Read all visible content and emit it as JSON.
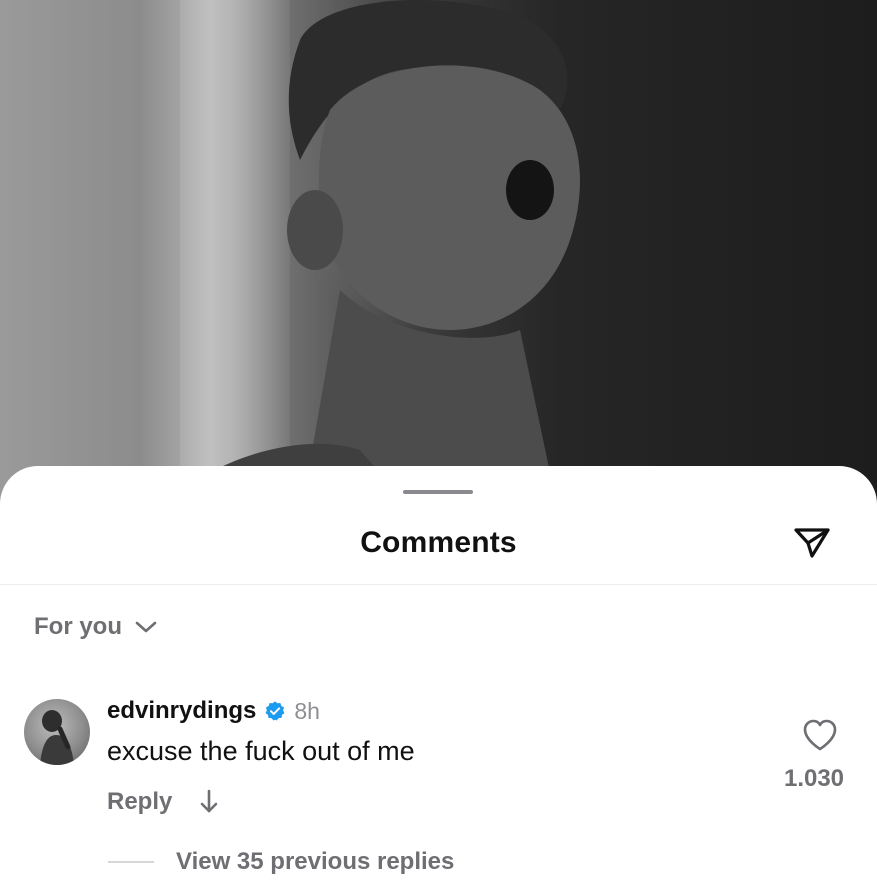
{
  "sheet": {
    "title": "Comments"
  },
  "filter": {
    "label": "For you"
  },
  "comment": {
    "username": "edvinrydings",
    "verified": true,
    "time": "8h",
    "text": "excuse the fuck out of me",
    "reply_label": "Reply",
    "like_count": "1.030",
    "view_replies_label": "View 35 previous replies"
  },
  "icons": {
    "send": "send-icon",
    "chevron": "chevron-down-icon",
    "verified": "verified-badge-icon",
    "arrow": "arrow-down-icon",
    "heart": "heart-icon"
  },
  "colors": {
    "verified_blue": "#1d9bf0",
    "muted_text": "#6e6e73"
  }
}
